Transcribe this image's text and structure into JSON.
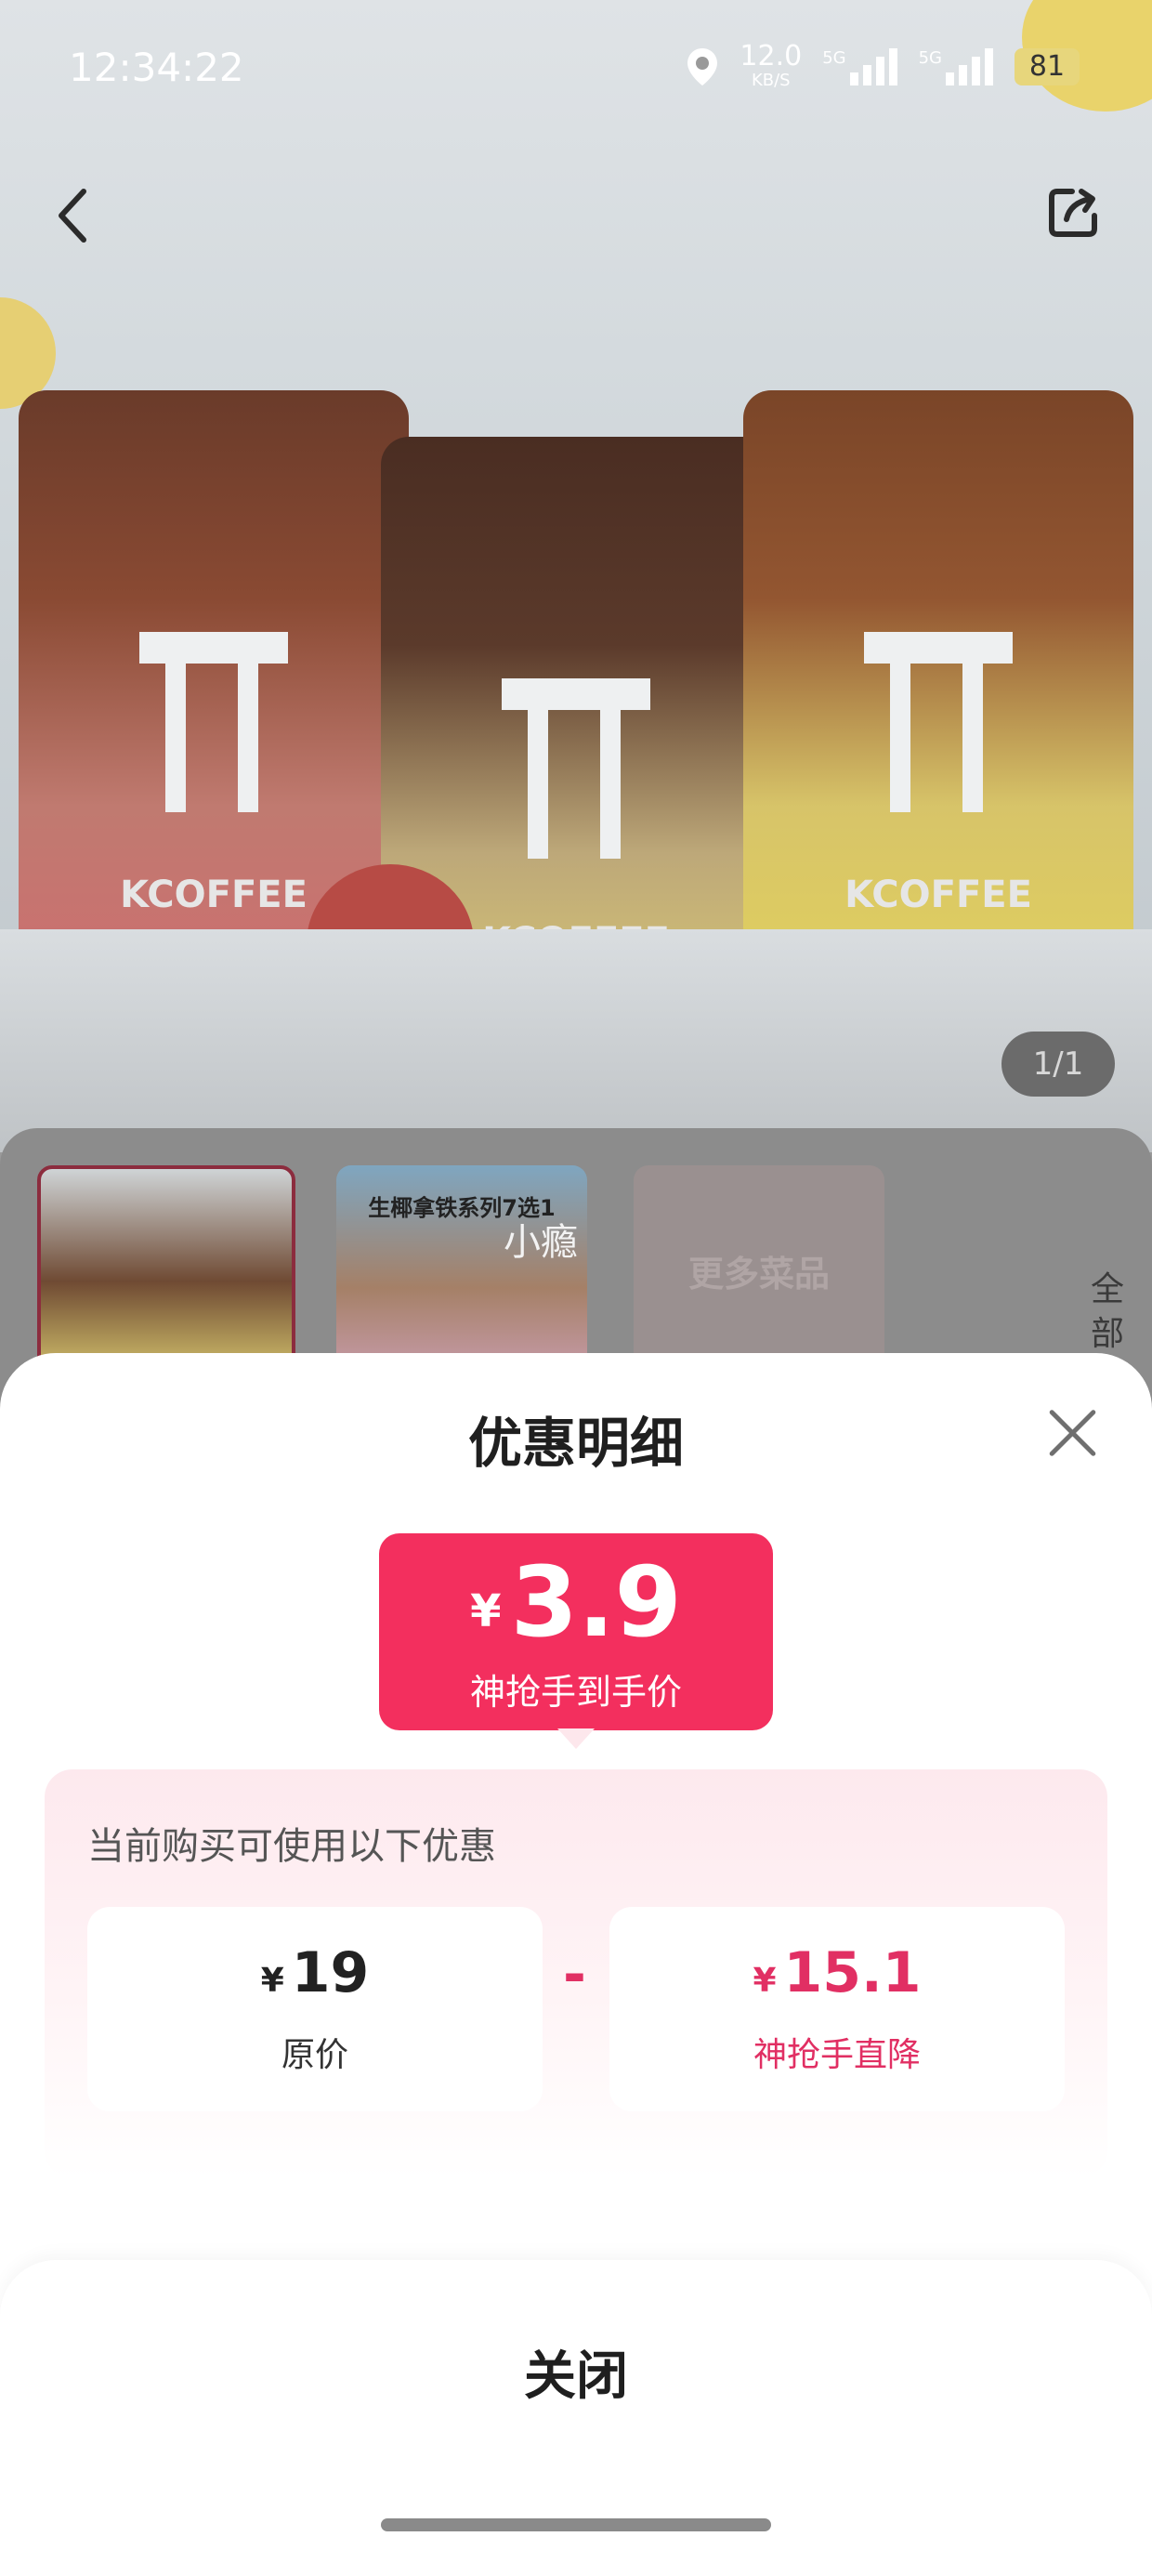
{
  "status_bar": {
    "time": "12:34:22",
    "network_speed": "12.0",
    "network_speed_unit": "KB/S",
    "signal1": "5G",
    "signal2": "5G",
    "battery": "81"
  },
  "hero": {
    "counter": "1/1",
    "cup_brand": "KCOFFEE"
  },
  "thumbnails": [
    {
      "caption": ""
    },
    {
      "caption": "生椰拿铁系列7选1"
    },
    {
      "caption": "更多菜品"
    }
  ],
  "overlay_text": "小瘾",
  "side_label": "全部",
  "sheet": {
    "title": "优惠明细",
    "price": {
      "currency": "¥",
      "amount": "3.9",
      "label": "神抢手到手价"
    },
    "discount_lead": "当前购买可使用以下优惠",
    "original": {
      "currency": "¥",
      "amount": "19",
      "label": "原价"
    },
    "operator": "-",
    "cut": {
      "currency": "¥",
      "amount": "15.1",
      "label": "神抢手直降"
    },
    "close_label": "关闭"
  },
  "colors": {
    "accent": "#f32f5e",
    "accent_text": "#e12f63"
  }
}
